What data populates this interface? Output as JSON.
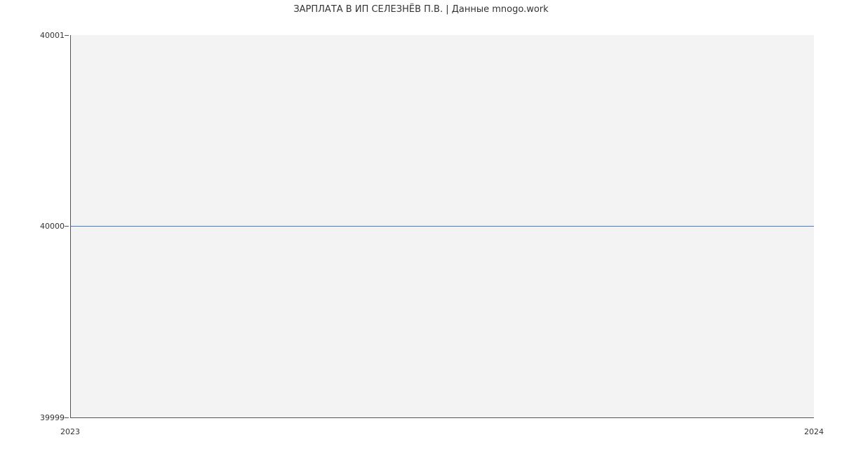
{
  "chart_data": {
    "type": "line",
    "title": "ЗАРПЛАТА В ИП СЕЛЕЗНЁВ П.В. | Данные mnogo.work",
    "x": [
      "2023",
      "2024"
    ],
    "y_ticks": [
      39999,
      40000,
      40001
    ],
    "series": [
      {
        "name": "salary",
        "values": [
          40000,
          40000
        ]
      }
    ],
    "ylim": [
      39999,
      40001
    ],
    "xlabel": "",
    "ylabel": ""
  },
  "labels": {
    "y_top": "40001",
    "y_mid": "40000",
    "y_bot": "39999",
    "x_left": "2023",
    "x_right": "2024"
  }
}
